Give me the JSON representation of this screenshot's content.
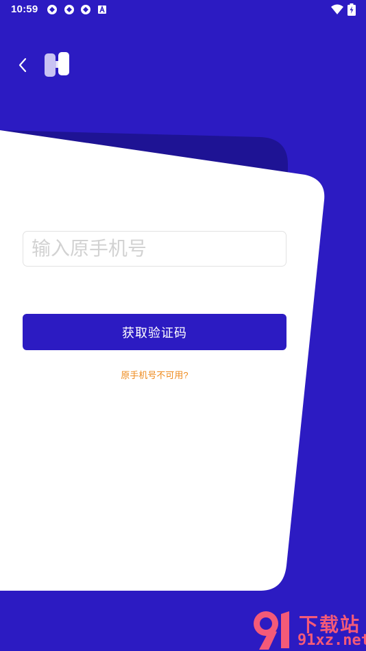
{
  "status_bar": {
    "time": "10:59",
    "left_icons": [
      "app-notification-icon",
      "app-notification-icon",
      "app-notification-icon",
      "text-a-icon"
    ],
    "right_icons": [
      "wifi-icon",
      "battery-charging-icon"
    ]
  },
  "header": {
    "back_icon": "chevron-left-icon",
    "logo": "app-logo"
  },
  "form": {
    "phone_placeholder": "输入原手机号",
    "phone_value": "",
    "get_code_label": "获取验证码",
    "unavailable_link": "原手机号不可用?"
  },
  "watermark": {
    "logo_text": "91",
    "title": "下载站",
    "domain": "91xz.net"
  },
  "colors": {
    "background": "#2c1bc2",
    "card_shadow": "#1e1394",
    "card": "#ffffff",
    "button": "#2c1bc2",
    "link": "#ee8a1c",
    "watermark": "#f45a78"
  }
}
